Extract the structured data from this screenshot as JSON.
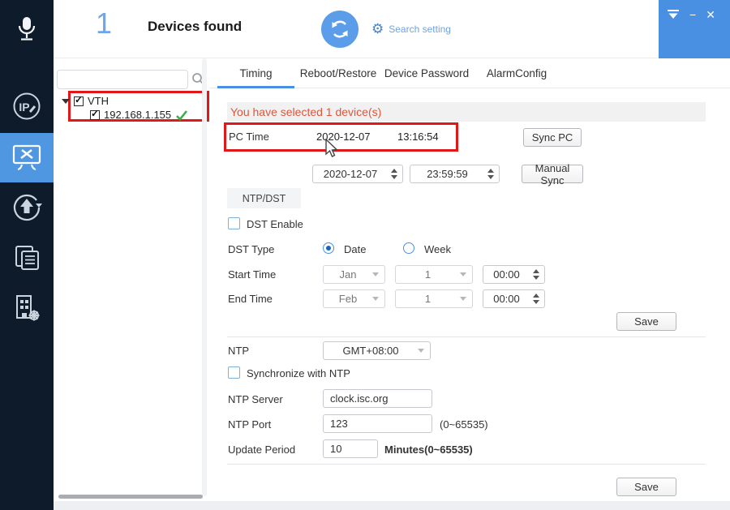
{
  "colors": {
    "accent": "#4a90e2",
    "sidebar_bg": "#0d1b2a",
    "sidebar_selected": "#4f97e0",
    "notice_text": "#e0543b",
    "annotation_red": "#e11818",
    "success_green": "#3cae4a"
  },
  "icons": {
    "gear": "⚙",
    "minimize": "−",
    "close": "✕",
    "check": "✓"
  },
  "header": {
    "device_count": "1",
    "devices_found_label": "Devices found",
    "search_setting_label": "Search setting"
  },
  "sidebar": {
    "items": [
      {
        "icon": "microphone-icon",
        "selected": false
      },
      {
        "icon": "ip-config-icon",
        "selected": false
      },
      {
        "icon": "device-config-icon",
        "selected": true
      },
      {
        "icon": "upgrade-icon",
        "selected": false
      },
      {
        "icon": "batch-docs-icon",
        "selected": false
      },
      {
        "icon": "building-config-icon",
        "selected": false
      }
    ]
  },
  "device_tree": {
    "search_value": "",
    "group": {
      "label": "VTH",
      "checked": true
    },
    "device": {
      "label": "192.168.1.155",
      "checked": true,
      "online": true
    }
  },
  "tabs": [
    {
      "label": "Timing",
      "active": true
    },
    {
      "label": "Reboot/Restore",
      "active": false
    },
    {
      "label": "Device Password",
      "active": false
    },
    {
      "label": "AlarmConfig",
      "active": false
    }
  ],
  "timing": {
    "selection_notice": "You have selected 1 device(s)",
    "pc_time": {
      "label": "PC Time",
      "date": "2020-12-07",
      "time": "13:16:54",
      "sync_button": "Sync PC"
    },
    "manual": {
      "date": "2020-12-07",
      "time": "23:59:59",
      "button": "Manual Sync"
    },
    "ntp_dst_tab": "NTP/DST",
    "dst": {
      "enable_label": "DST Enable",
      "enabled": false,
      "type_label": "DST Type",
      "date_label": "Date",
      "week_label": "Week",
      "selected_type": "Date",
      "start": {
        "label": "Start Time",
        "month": "Jan",
        "day": "1",
        "time": "00:00"
      },
      "end": {
        "label": "End Time",
        "month": "Feb",
        "day": "1",
        "time": "00:00"
      }
    },
    "save_button": "Save",
    "ntp": {
      "label": "NTP",
      "timezone": "GMT+08:00",
      "sync_label": "Synchronize with NTP",
      "sync_enabled": false,
      "server_label": "NTP Server",
      "server": "clock.isc.org",
      "port_label": "NTP Port",
      "port": "123",
      "port_hint": "(0~65535)",
      "period_label": "Update Period",
      "period": "10",
      "period_hint": "Minutes(0~65535)",
      "save_button": "Save"
    }
  }
}
